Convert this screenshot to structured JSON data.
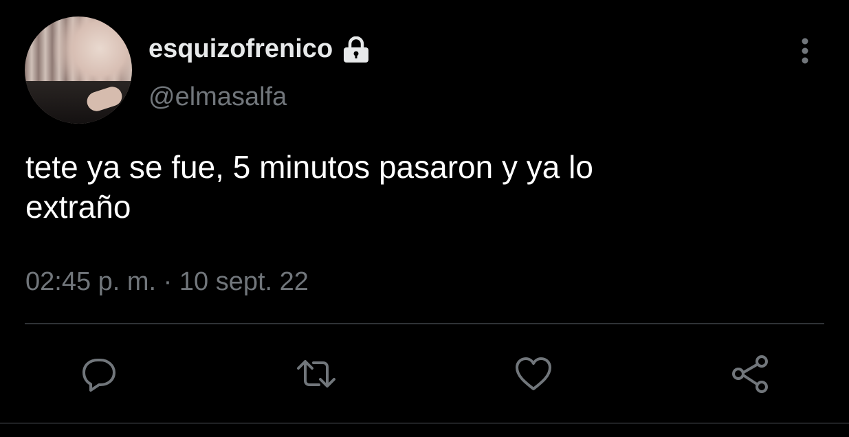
{
  "tweet": {
    "display_name": "esquizofrenico",
    "handle": "@elmasalfa",
    "text": "tete ya se fue, 5 minutos pasaron y ya lo\nextraño",
    "timestamp": "02:45 p. m. · 10 sept. 22"
  },
  "icons": {
    "protected": "lock-icon",
    "more": "more-vertical-icon",
    "reply": "reply-icon",
    "retweet": "retweet-icon",
    "like": "heart-icon",
    "share": "share-icon"
  },
  "colors": {
    "background": "#000000",
    "primary_text": "#e7e9ea",
    "secondary_text": "#71767b",
    "divider": "#2f3336",
    "icon": "#71767b"
  }
}
